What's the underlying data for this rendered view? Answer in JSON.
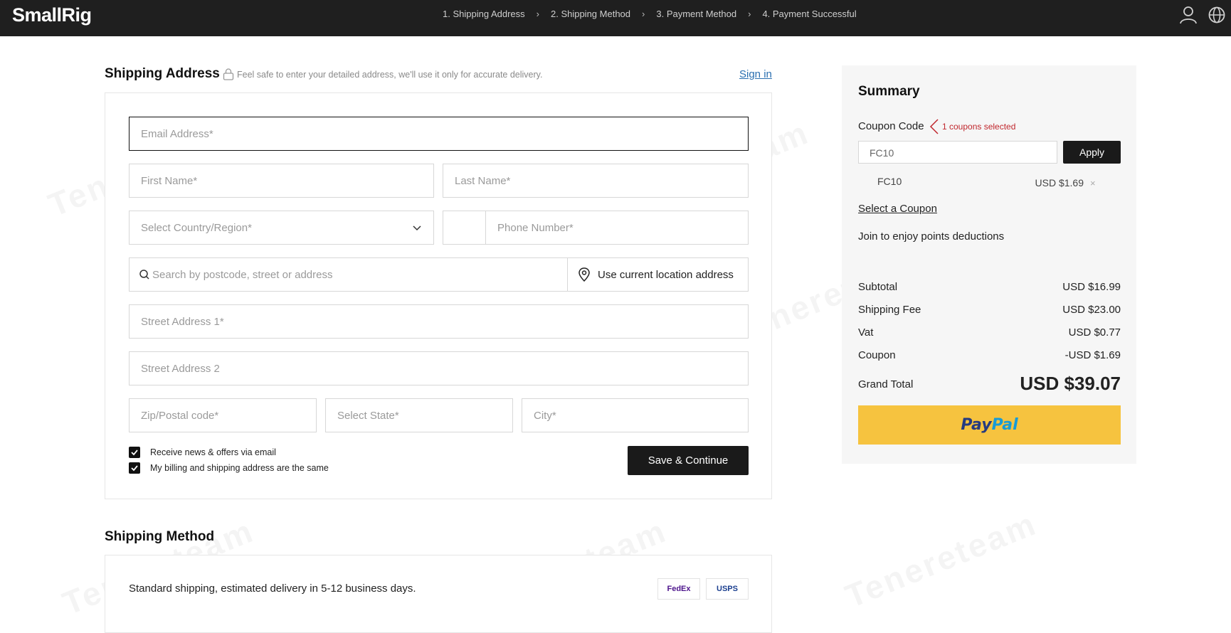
{
  "header": {
    "logo": "SmallRig",
    "steps": [
      "1. Shipping Address",
      "2. Shipping Method",
      "3. Payment Method",
      "4. Payment Successful"
    ],
    "icons": [
      "user-icon",
      "globe-icon"
    ]
  },
  "shipping_address": {
    "title": "Shipping Address",
    "safe_note": "Feel safe to enter your detailed address, we'll use it only for accurate delivery.",
    "sign_in": "Sign in",
    "fields": {
      "email": "Email Address*",
      "first_name": "First Name*",
      "last_name": "Last Name*",
      "country": "Select Country/Region*",
      "phone": "Phone Number*",
      "search": "Search by postcode, street or address",
      "use_location": "Use current location address",
      "street1": "Street Address 1*",
      "street2": "Street Address 2",
      "zip": "Zip/Postal code*",
      "state": "Select State*",
      "city": "City*"
    },
    "checkbox_news": "Receive news & offers via email",
    "checkbox_billing": "My billing and shipping address are the same",
    "save_button": "Save & Continue"
  },
  "shipping_method": {
    "title": "Shipping Method",
    "option": "Standard shipping, estimated delivery in 5-12 business days.",
    "carriers": [
      "FedEx",
      "USPS"
    ]
  },
  "summary": {
    "title": "Summary",
    "coupon_label": "Coupon Code",
    "coupon_note": "1 coupons selected",
    "coupon_value": "FC10",
    "apply": "Apply",
    "applied_code": "FC10",
    "applied_amount": "USD $1.69",
    "select_coupon": "Select a Coupon",
    "points_note": "Join to enjoy points deductions",
    "rows": [
      {
        "label": "Subtotal",
        "value": "USD $16.99"
      },
      {
        "label": "Shipping Fee",
        "value": "USD $23.00"
      },
      {
        "label": "Vat",
        "value": "USD $0.77"
      },
      {
        "label": "Coupon",
        "value": "-USD $1.69"
      }
    ],
    "grand_total_label": "Grand Total",
    "grand_total_value": "USD $39.07",
    "paypal_label": "PayPal"
  },
  "colors": {
    "header_bg": "#1f1f1f",
    "paypal_yellow": "#f6c33f",
    "coupon_red": "#c0272d",
    "link_blue": "#2a6fb0"
  }
}
